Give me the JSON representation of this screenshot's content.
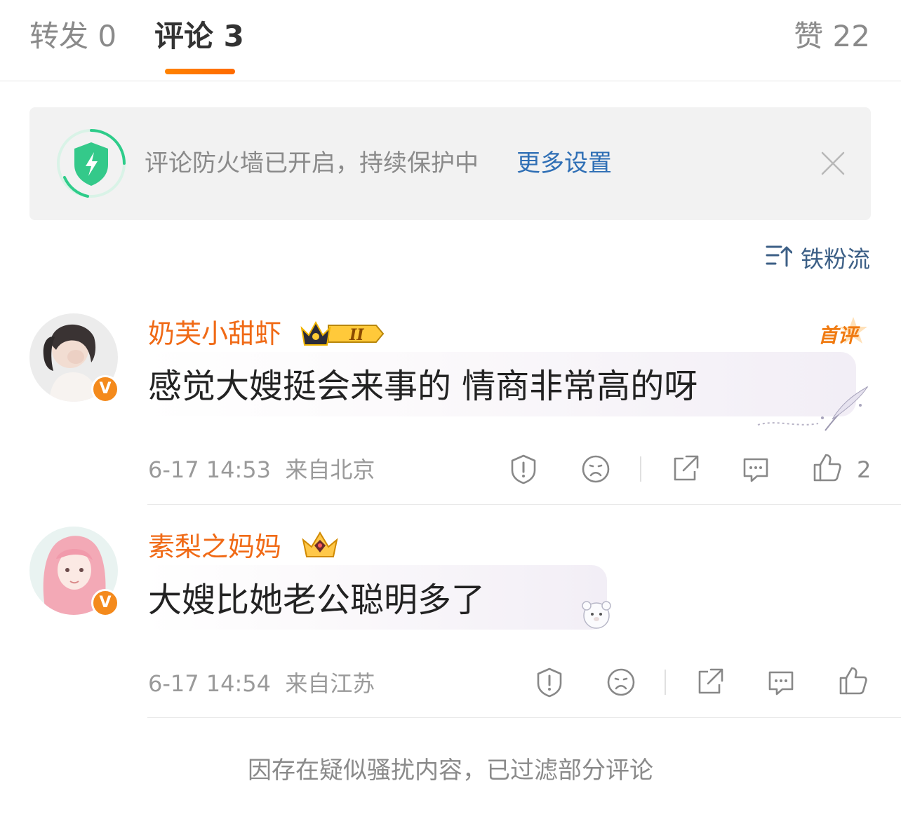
{
  "tabs": {
    "repost": "转发 0",
    "comments": "评论 3",
    "likes": "赞 22"
  },
  "firewall": {
    "text": "评论防火墙已开启，持续保护中",
    "link": "更多设置"
  },
  "sort": {
    "label": "铁粉流"
  },
  "comments": [
    {
      "username": "奶芙小甜虾",
      "badge": "first-comment-badge",
      "badge_text": "首评",
      "text": "感觉大嫂挺会来事的 情商非常高的呀",
      "time": "6-17 14:53",
      "location": "来自北京",
      "like_count": "2"
    },
    {
      "username": "素梨之妈妈",
      "text": "大嫂比她老公聪明多了",
      "time": "6-17 14:54",
      "location": "来自江苏",
      "like_count": ""
    }
  ],
  "footer": {
    "note": "因存在疑似骚扰内容，已过滤部分评论"
  },
  "colors": {
    "accent": "#ff8200",
    "username": "#f06a16",
    "link": "#2f6fb5",
    "shield": "#2ecc8a"
  }
}
